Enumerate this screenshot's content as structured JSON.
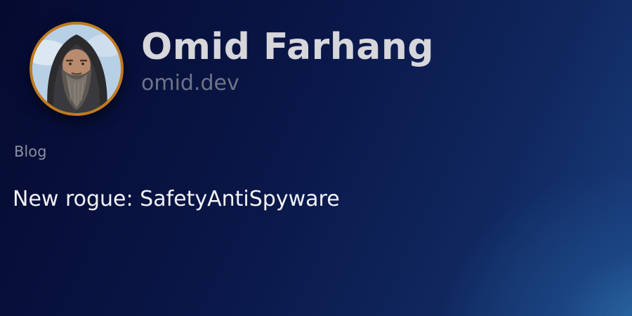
{
  "profile": {
    "name": "Omid Farhang",
    "domain": "omid.dev",
    "avatar_icon": "user-portrait-icon",
    "avatar_border_color": "#c07a1e"
  },
  "section": {
    "label": "Blog"
  },
  "post": {
    "title": "New rogue: SafetyAntiSpyware"
  },
  "colors": {
    "background_dark": "#050a30",
    "background_light": "#2c6ea8",
    "name_text": "#d6d6db",
    "domain_text": "#6e7487",
    "label_text": "#8a8f9e",
    "title_text": "#f2f3f7"
  }
}
